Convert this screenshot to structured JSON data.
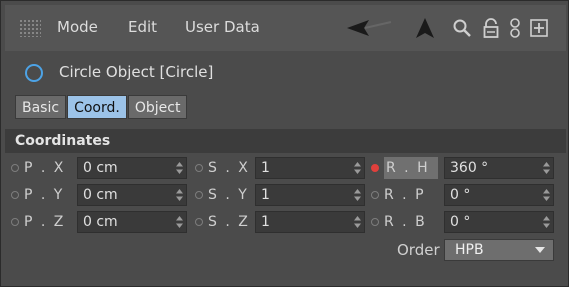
{
  "menu": {
    "items": [
      "Mode",
      "Edit",
      "User Data"
    ],
    "tool_icons": [
      "back-arrow-icon",
      "up-arrow-icon",
      "search-icon",
      "lock-icon",
      "chain-icon",
      "add-panel-icon"
    ]
  },
  "object": {
    "title": "Circle Object [Circle]",
    "icon": "circle-icon",
    "icon_color": "#4da3e6"
  },
  "tabs": [
    {
      "label": "Basic",
      "active": false
    },
    {
      "label": "Coord.",
      "active": true
    },
    {
      "label": "Object",
      "active": false
    }
  ],
  "section": {
    "title": "Coordinates"
  },
  "params": [
    {
      "label": "P . X",
      "value": "0 cm"
    },
    {
      "label": "S . X",
      "value": "1"
    },
    {
      "label": "R . H",
      "value": "360 °",
      "keyed": true
    },
    {
      "label": "P . Y",
      "value": "0 cm"
    },
    {
      "label": "S . Y",
      "value": "1"
    },
    {
      "label": "R . P",
      "value": "0 °"
    },
    {
      "label": "P . Z",
      "value": "0 cm"
    },
    {
      "label": "S . Z",
      "value": "1"
    },
    {
      "label": "R . B",
      "value": "0 °"
    }
  ],
  "order": {
    "label": "Order",
    "value": "HPB"
  },
  "colors": {
    "active_tab": "#9cc3e8",
    "keyframe_dot": "#e0403c"
  }
}
